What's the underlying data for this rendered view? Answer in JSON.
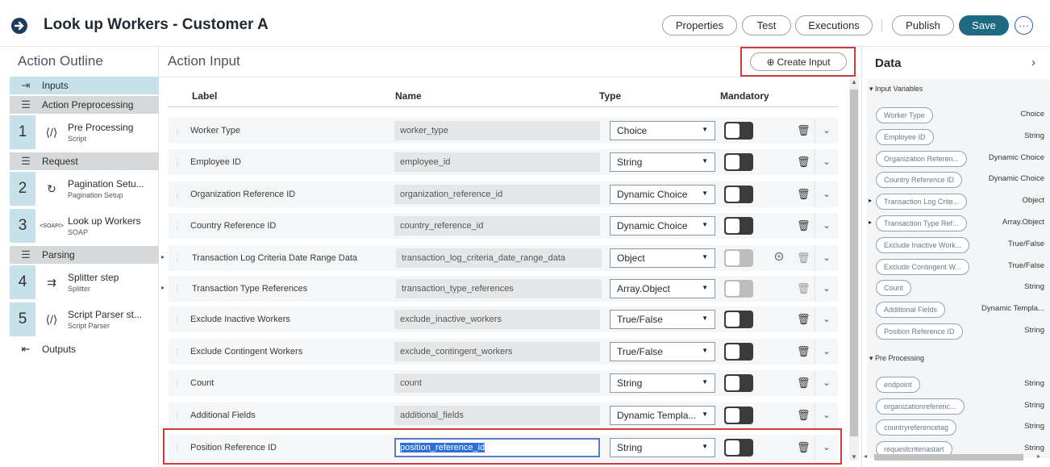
{
  "header": {
    "title": "Look up Workers - Customer A",
    "buttons": {
      "properties": "Properties",
      "test": "Test",
      "executions": "Executions",
      "publish": "Publish",
      "save": "Save",
      "more": "···"
    }
  },
  "sidebar": {
    "title": "Action Outline",
    "inputs": "Inputs",
    "action_preprocessing": "Action Preprocessing",
    "request": "Request",
    "parsing": "Parsing",
    "outputs": "Outputs",
    "steps": [
      {
        "num": "1",
        "title": "Pre Processing",
        "subtitle": "Script"
      },
      {
        "num": "2",
        "title": "Pagination Setu...",
        "subtitle": "Pagination Setup"
      },
      {
        "num": "3",
        "title": "Look up Workers",
        "subtitle": "SOAP"
      },
      {
        "num": "4",
        "title": "Splitter step",
        "subtitle": "Splitter"
      },
      {
        "num": "5",
        "title": "Script Parser st...",
        "subtitle": "Script Parser"
      }
    ]
  },
  "main": {
    "title": "Action Input",
    "create_input": "Create Input",
    "columns": {
      "label": "Label",
      "name": "Name",
      "type": "Type",
      "mandatory": "Mandatory"
    },
    "rows": [
      {
        "label": "Worker Type",
        "name": "worker_type",
        "type": "Choice"
      },
      {
        "label": "Employee ID",
        "name": "employee_id",
        "type": "String"
      },
      {
        "label": "Organization Reference ID",
        "name": "organization_reference_id",
        "type": "Dynamic Choice"
      },
      {
        "label": "Country Reference ID",
        "name": "country_reference_id",
        "type": "Dynamic Choice"
      },
      {
        "label": "Transaction Log Criteria Date Range Data",
        "name": "transaction_log_criteria_date_range_data",
        "type": "Object"
      },
      {
        "label": "Transaction Type References",
        "name": "transaction_type_references",
        "type": "Array.Object"
      },
      {
        "label": "Exclude Inactive Workers",
        "name": "exclude_inactive_workers",
        "type": "True/False"
      },
      {
        "label": "Exclude Contingent Workers",
        "name": "exclude_contingent_workers",
        "type": "True/False"
      },
      {
        "label": "Count",
        "name": "count",
        "type": "String"
      },
      {
        "label": "Additional Fields",
        "name": "additional_fields",
        "type": "Dynamic Templa..."
      },
      {
        "label": "Position Reference ID",
        "name": "position_reference_id",
        "type": "String"
      }
    ]
  },
  "data_panel": {
    "title": "Data",
    "input_variables_label": "Input Variables",
    "input_variables": [
      {
        "name": "Worker Type",
        "type": "Choice"
      },
      {
        "name": "Employee ID",
        "type": "String"
      },
      {
        "name": "Organization Referen...",
        "type": "Dynamic Choice"
      },
      {
        "name": "Country Reference ID",
        "type": "Dynamic Choice"
      },
      {
        "name": "Transaction Log Crite...",
        "type": "Object"
      },
      {
        "name": "Transaction Type Ref...",
        "type": "Array.Object"
      },
      {
        "name": "Exclude Inactive Work...",
        "type": "True/False"
      },
      {
        "name": "Exclude Contingent W...",
        "type": "True/False"
      },
      {
        "name": "Count",
        "type": "String"
      },
      {
        "name": "Additional Fields",
        "type": "Dynamic Templa..."
      },
      {
        "name": "Position Reference ID",
        "type": "String"
      }
    ],
    "pre_processing_label": "Pre Processing",
    "pre_processing": [
      {
        "name": "endpoint",
        "type": "String"
      },
      {
        "name": "organizationreferenc...",
        "type": "String"
      },
      {
        "name": "countryreferencetag",
        "type": "String"
      },
      {
        "name": "requestcriteriastart",
        "type": "String"
      }
    ]
  },
  "colors": {
    "accent": "#1e6a80",
    "highlight": "#d03a3a",
    "step_bg": "#c6e1ea"
  }
}
